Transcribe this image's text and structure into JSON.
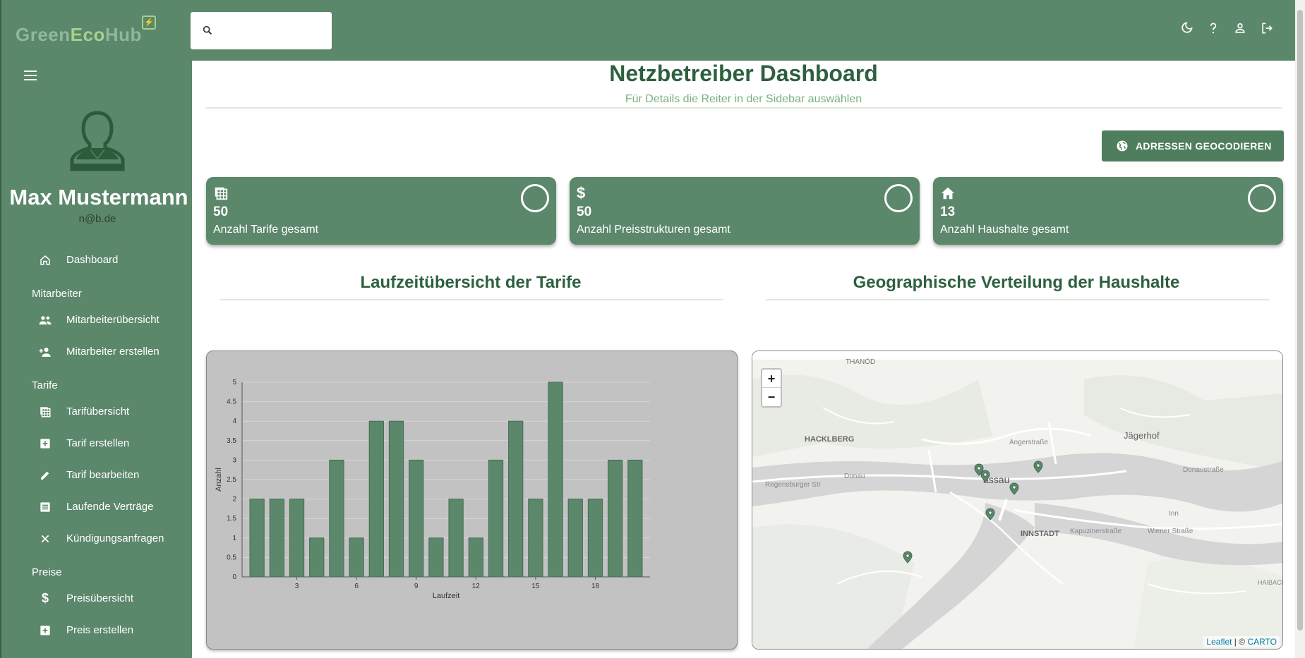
{
  "app": {
    "logo_part1": "Green",
    "logo_part2": "Eco",
    "logo_part3": "Hub"
  },
  "search": {
    "placeholder": ""
  },
  "top_icons": [
    "dark-mode-icon",
    "help-icon",
    "account-icon",
    "logout-icon"
  ],
  "user": {
    "name": "Max Mustermann",
    "email": "n@b.de"
  },
  "sidebar": {
    "dashboard": "Dashboard",
    "section_mitarbeiter": "Mitarbeiter",
    "mitarbeiter_uebersicht": "Mitarbeiterübersicht",
    "mitarbeiter_erstellen": "Mitarbeiter erstellen",
    "section_tarife": "Tarife",
    "tarif_uebersicht": "Tarifübersicht",
    "tarif_erstellen": "Tarif erstellen",
    "tarif_bearbeiten": "Tarif bearbeiten",
    "laufende_vertraege": "Laufende Verträge",
    "kuendigungsanfragen": "Kündigungsanfragen",
    "section_preise": "Preise",
    "preis_uebersicht": "Preisübersicht",
    "preis_erstellen": "Preis erstellen"
  },
  "main": {
    "title": "Netzbetreiber Dashboard",
    "subtitle": "Für Details die Reiter in der Sidebar auswählen",
    "geocode_button": "ADRESSEN GEOCODIEREN",
    "cards": [
      {
        "value": "50",
        "label": "Anzahl Tarife gesamt"
      },
      {
        "value": "50",
        "label": "Anzahl Preisstrukturen gesamt"
      },
      {
        "value": "13",
        "label": "Anzahl Haushalte gesamt"
      }
    ],
    "chart_title": "Laufzeitübersicht der Tarife",
    "map_title": "Geographische Verteilung der Haushalte"
  },
  "map": {
    "zoom_in": "+",
    "zoom_out": "−",
    "labels": [
      "THANÖD",
      "HACKLBERG",
      "Jägerhof",
      "assau",
      "INNSTADT",
      "Donau",
      "Regensburger Str",
      "Angerstraße",
      "Donaustraße",
      "Kapuzinerstraße",
      "Wiener Straße",
      "Inn",
      "HAIBACH SCHARD"
    ],
    "attribution_leaflet": "Leaflet",
    "attribution_sep": " | © ",
    "attribution_carto": "CARTO"
  },
  "chart_data": {
    "type": "bar",
    "categories": [
      1,
      2,
      3,
      4,
      5,
      6,
      7,
      8,
      9,
      10,
      11,
      12,
      13,
      14,
      15,
      16,
      17,
      18,
      19,
      20
    ],
    "values": [
      2,
      2,
      2,
      1,
      3,
      1,
      4,
      4,
      3,
      1,
      2,
      1,
      3,
      4,
      2,
      5,
      2,
      2,
      3,
      3
    ],
    "xticks": [
      3,
      6,
      9,
      12,
      15,
      18
    ],
    "yticks": [
      0,
      0.5,
      1,
      1.5,
      2,
      2.5,
      3,
      3.5,
      4,
      4.5,
      5
    ],
    "xlabel": "Laufzeit",
    "ylabel": "Anzahl",
    "ylim": [
      0,
      5
    ],
    "bar_color": "#5b876b",
    "grid": true
  },
  "colors": {
    "accent": "#5b876b",
    "title": "#2e6040",
    "subtitle": "#7ab07f"
  }
}
